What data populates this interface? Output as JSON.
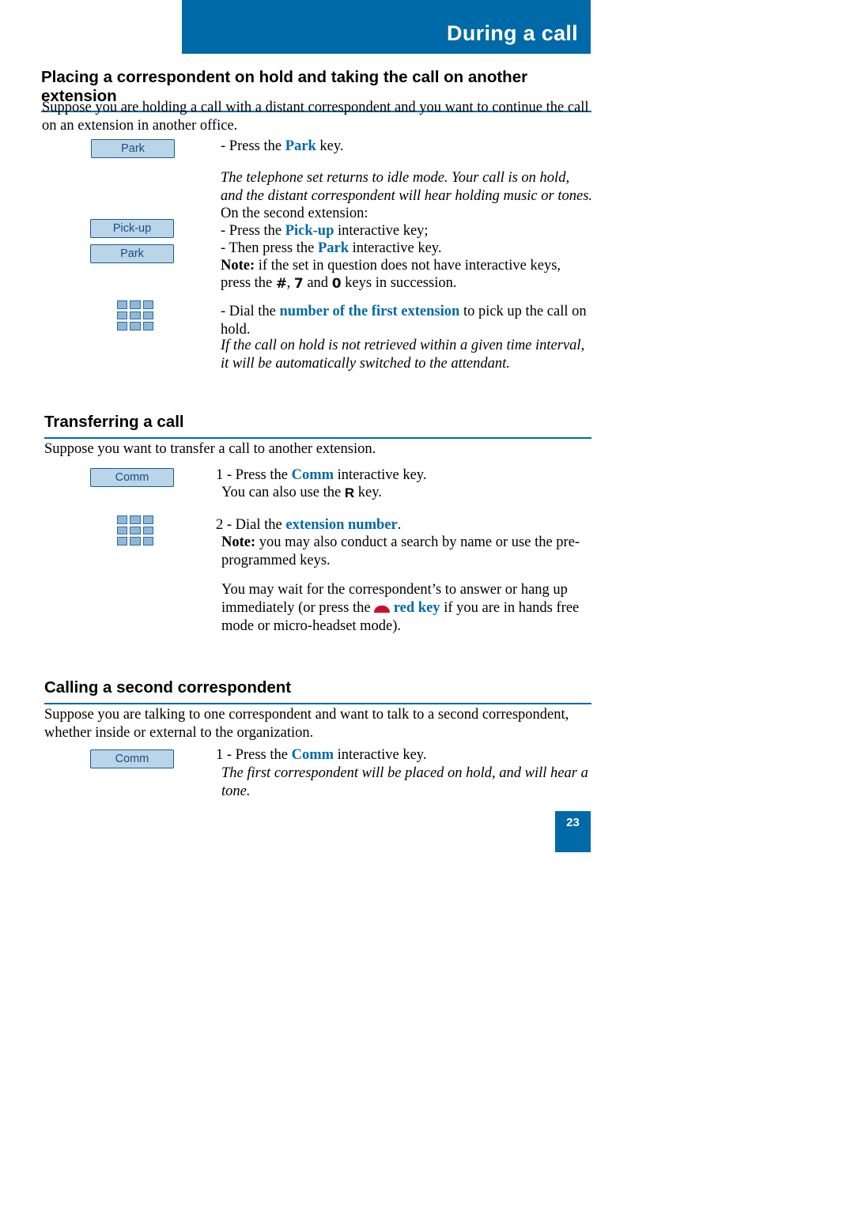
{
  "header": {
    "title": "During a call"
  },
  "colors": {
    "accent": "#0069a7",
    "key_fill": "#bad4e8",
    "key_text": "#1b4f7e",
    "red": "#c8102e"
  },
  "sections": {
    "section1": {
      "heading": "Placing a correspondent on hold and taking the call on another extension",
      "intro": "Suppose you are holding a call with a distant correspondent and you want to continue the call on an extension in another office.",
      "keys": {
        "park1": "Park",
        "pickup": "Pick-up",
        "park2": "Park"
      },
      "step1_lead": "- Press the ",
      "step1_key": "Park",
      "step1_tail": " key.",
      "step1_italic": "The telephone set returns to idle mode. Your call is on hold, and the distant correspondent will hear holding music or tones.",
      "step2_line1": "On the second extension:",
      "step2_line2_lead": "- Press the ",
      "step2_line2_key": "Pick-up",
      "step2_line2_tail": " interactive key;",
      "step2_line3_lead": "- Then press the ",
      "step2_line3_key": "Park",
      "step2_line3_tail": " interactive key.",
      "note_label": "Note:",
      "note_text": " if the set in question does not have interactive keys,",
      "note_text2_lead": "press the ",
      "note_glyph_hash": "#",
      "note_glyph_sep": ", ",
      "note_glyph_7": "7",
      "note_glyph_and": " and ",
      "note_glyph_0": "0",
      "note_text2_tail": " keys in succession.",
      "step3_lead": "- Dial the ",
      "step3_key": "number of the first extension",
      "step3_tail": " to pick up the call on hold.",
      "step3_italic": "If the call on hold is not retrieved within a given time interval, it will be automatically switched to the attendant."
    },
    "section2": {
      "heading": "Transferring a call",
      "intro": "Suppose you want to transfer a call to another extension.",
      "keys": {
        "comm": "Comm"
      },
      "step1_lead": "1 - Press the ",
      "step1_key": "Comm",
      "step1_tail": " interactive key.",
      "step1_line2_lead": "You can also use the ",
      "step1_line2_glyph": "R",
      "step1_line2_tail": " key.",
      "step2_lead": "2 - Dial the ",
      "step2_key": "extension number",
      "step2_tail": ".",
      "step2_note_label": "Note:",
      "step2_note_text": " you may also conduct a search by name or use the pre-programmed keys.",
      "step3_lead": "You may wait for the correspondent’s to answer or hang up immediately (or press the ",
      "step3_key": "red key",
      "step3_tail": " if you are in hands free mode or micro-headset mode)."
    },
    "section3": {
      "heading": "Calling a second correspondent",
      "intro": "Suppose you are talking to one correspondent and want to talk to a second correspondent, whether inside or external to the organization.",
      "keys": {
        "comm": "Comm"
      },
      "step1_lead": "1 - Press the ",
      "step1_key": "Comm",
      "step1_tail": " interactive key.",
      "step1_italic": "The first correspondent will be placed on hold, and will hear a tone."
    }
  },
  "footer": {
    "page_number": "23"
  }
}
